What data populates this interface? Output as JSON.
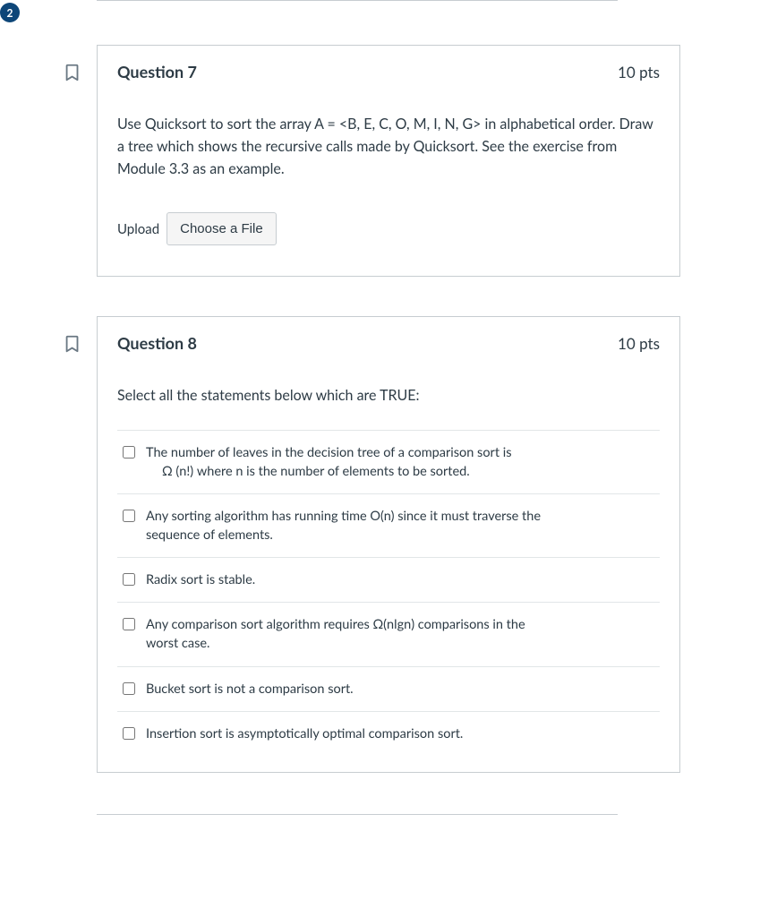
{
  "page_badge": "2",
  "questions": [
    {
      "number_label": "Question 7",
      "points_label": "10 pts",
      "prompt": "Use Quicksort to sort the array A = <B, E, C, O, M, I, N, G> in alphabetical order. Draw a tree which shows the recursive calls made by Quicksort. See the exercise from Module 3.3 as an example.",
      "upload_label": "Upload",
      "choose_file_label": "Choose a File"
    },
    {
      "number_label": "Question 8",
      "points_label": "10 pts",
      "select_prompt": "Select all the statements below which are TRUE:",
      "options": [
        {
          "text_line1": "The number of leaves in the decision tree of a comparison sort is",
          "text_line2": "Ω (n!) where n is the number of elements to be sorted."
        },
        {
          "text_line1": "Any sorting algorithm has running time O(n) since it must traverse the",
          "text_line2": "sequence of elements."
        },
        {
          "text_line1": "Radix sort is stable."
        },
        {
          "text_line1": "Any comparison sort algorithm requires Ω(nlgn) comparisons in the",
          "text_line2": "worst case."
        },
        {
          "text_line1": "Bucket sort is not a comparison sort."
        },
        {
          "text_line1": "Insertion sort is asymptotically optimal comparison sort."
        }
      ]
    }
  ]
}
